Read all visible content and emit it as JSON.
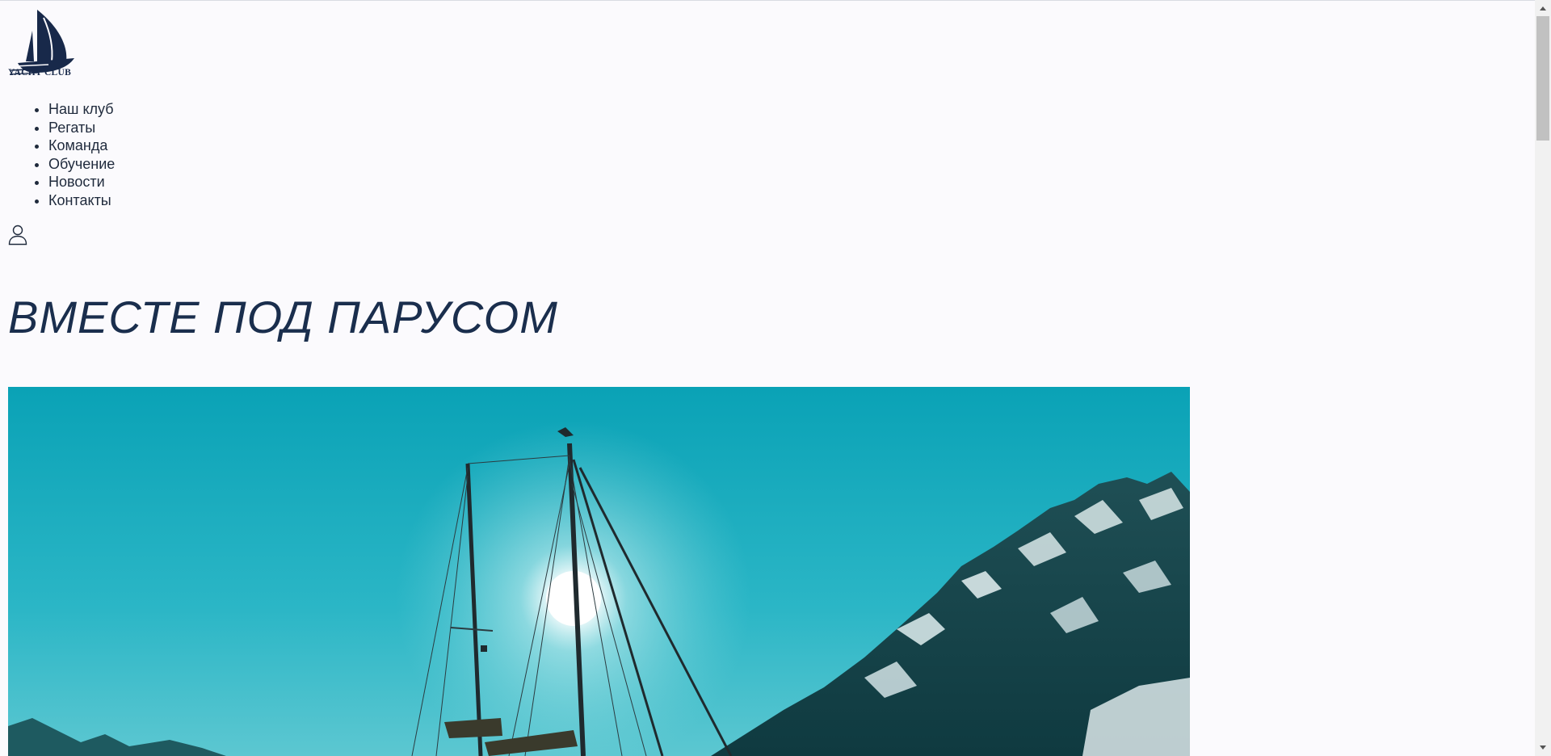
{
  "header": {
    "logo_text": "YACHT CLUB",
    "logo_icon": "sailboat-logo-icon",
    "account_icon": "user-icon"
  },
  "nav": {
    "items": [
      {
        "label": "Наш клуб"
      },
      {
        "label": "Регаты"
      },
      {
        "label": "Команда"
      },
      {
        "label": "Обучение"
      },
      {
        "label": "Новости"
      },
      {
        "label": "Контакты"
      }
    ]
  },
  "hero": {
    "title": "ВМЕСТЕ ПОД ПАРУСОМ"
  },
  "colors": {
    "background": "#fbfafd",
    "brand_navy": "#1a2e4d",
    "sky_teal": "#1fa9b8"
  }
}
